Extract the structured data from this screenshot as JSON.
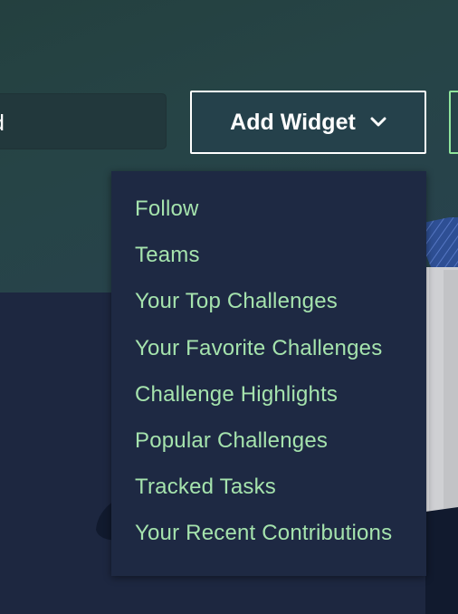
{
  "search": {
    "visible_text": "d"
  },
  "add_widget": {
    "label": "Add Widget",
    "icon": "chevron-down-icon"
  },
  "dropdown": {
    "items": [
      {
        "label": "Follow"
      },
      {
        "label": "Teams"
      },
      {
        "label": "Your Top Challenges"
      },
      {
        "label": "Your Favorite Challenges"
      },
      {
        "label": "Challenge Highlights"
      },
      {
        "label": "Popular Challenges"
      },
      {
        "label": "Tracked Tasks"
      },
      {
        "label": "Your Recent Contributions"
      }
    ]
  },
  "colors": {
    "page_background": "#1d2740",
    "header_background": "#264446",
    "menu_background": "#1e2943",
    "menu_text": "#a5e3ad",
    "accent_green": "#8fe59b",
    "button_border": "#ffffff"
  }
}
